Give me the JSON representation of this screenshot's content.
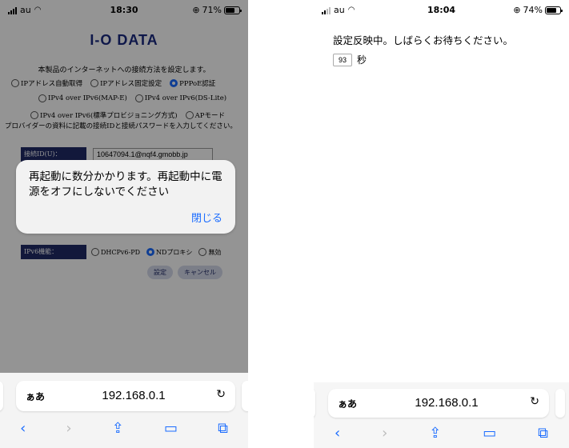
{
  "left": {
    "status": {
      "carrier": "au",
      "time": "18:30",
      "battery_text": "71%",
      "battery_level": 0.71
    },
    "page": {
      "logo": "I-O DATA",
      "intro": "本製品のインターネットへの接続方法を設定します。",
      "options_row1": [
        "IPアドレス自動取得",
        "IPアドレス固定設定",
        "PPPoE認証"
      ],
      "options_row2": [
        "IPv4 over IPv6(MAP-E)",
        "IPv4 over IPv6(DS-Lite)"
      ],
      "options_row3": [
        "IPv4 over IPv6(標準プロビジョニング方式)",
        "APモード"
      ],
      "selected_option": "PPPoE認証",
      "notice": "プロバイダーの資料に記載の接続IDと接続パスワードを入力してください。",
      "id_label": "接続ID(U)：",
      "id_value": "10647094.1@nqf4.gmobb.jp",
      "ipv6_label": "IPv6機能：",
      "ipv6_options": [
        "DHCPv6-PD",
        "NDプロキシ",
        "無効"
      ],
      "ipv6_selected": "NDプロキシ",
      "set_button": "設定",
      "cancel_button": "キャンセル"
    },
    "alert": {
      "message": "再起動に数分かかります。再起動中に電源をオフにしないでください",
      "close": "閉じる"
    },
    "safari": {
      "aa": "ぁあ",
      "url": "192.168.0.1"
    }
  },
  "right": {
    "status": {
      "carrier": "au",
      "time": "18:04",
      "battery_text": "74%",
      "battery_level": 0.74
    },
    "message": "設定反映中。しばらくお待ちください。",
    "countdown": "93",
    "unit": "秒",
    "safari": {
      "aa": "ぁあ",
      "url": "192.168.0.1"
    }
  }
}
